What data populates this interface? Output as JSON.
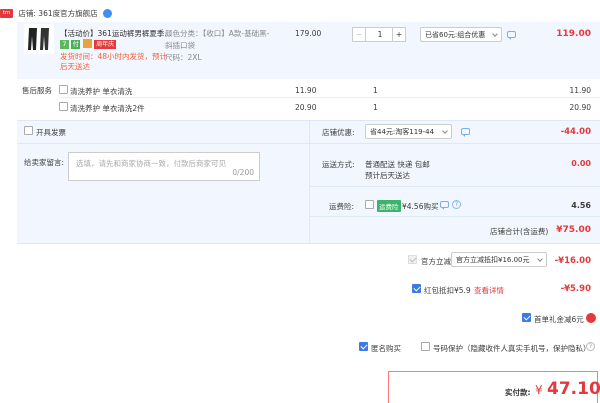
{
  "shop": {
    "badge": "tm",
    "label": "店铺: 361度官方旗舰店"
  },
  "item": {
    "title_line1": "【活动价】361运动裤男裤夏季...",
    "badge_7": "7",
    "badge_pay": "付",
    "badge_cheap": "周年庆",
    "shipping_line1": "发货时间：48小时内发货，预计",
    "shipping_line2": "后天送达",
    "sku_line1": "颜色分类：【收口】A款-基础黑-",
    "sku_line2": "斜插口袋",
    "sku_line3": "尺码：2XL",
    "price": "179.00",
    "quantity": "1",
    "discount_select": "已省60元:组合优惠",
    "subtotal": "119.00"
  },
  "after_sales": {
    "label": "售后服务",
    "options": [
      {
        "label": "清洗养护  单衣清洗",
        "price": "11.90",
        "qty": "1",
        "total": "11.90"
      },
      {
        "label": "清洗养护  单衣清洗2件",
        "price": "20.90",
        "qty": "1",
        "total": "20.90"
      }
    ]
  },
  "invoice": {
    "label": "开具发票"
  },
  "shop_discount": {
    "label": "店铺优惠:",
    "select": "省44元:淘客119-44",
    "value": "-44.00"
  },
  "message": {
    "label": "给卖家留言:",
    "placeholder": "选填，请先和商家协商一致，付款后商家可见",
    "counter": "0/200"
  },
  "delivery": {
    "label": "运送方式:",
    "method": "普通配送 快递 包邮",
    "eta": "预计后天送达",
    "value": "0.00"
  },
  "insurance": {
    "label": "运费险:",
    "tag": "运费险",
    "text": "¥4.56购买",
    "value": "4.56"
  },
  "shop_total": {
    "label": "店铺合计(含运费)",
    "value": "¥75.00"
  },
  "official": {
    "label": "官方立减",
    "select": "官方立减抵扣¥16.00元",
    "value": "-¥16.00"
  },
  "redpacket": {
    "label": "红包抵扣¥5.9",
    "link": "查看详情",
    "value": "-¥5.90"
  },
  "first_gift": {
    "label": "首单礼金减6元"
  },
  "anonymous": {
    "label": "匿名购买"
  },
  "privacy": {
    "label": "号码保护（隐藏收件人真实手机号，保护隐私）"
  },
  "actual": {
    "label": "实付款:",
    "currency": "¥",
    "amount": "47.10"
  },
  "colors": {
    "accent": "#e4393c",
    "panel": "#f2f7ff",
    "blue": "#3d7ae6"
  }
}
